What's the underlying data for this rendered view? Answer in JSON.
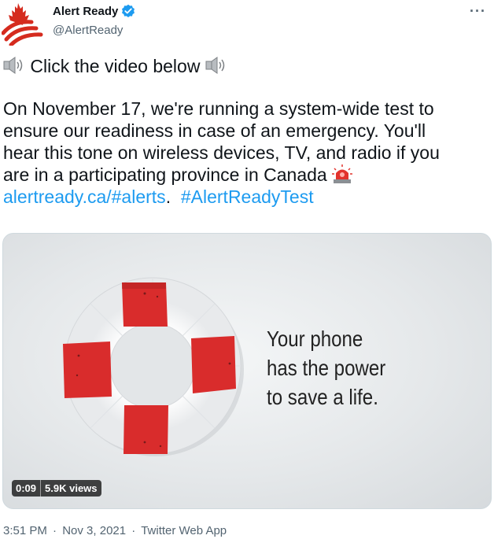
{
  "header": {
    "display_name": "Alert Ready",
    "handle": "@AlertReady",
    "more_label": "···"
  },
  "tweet": {
    "line1": "Click the video below",
    "para_lines": [
      "On November 17, we're running a system-wide test to",
      "ensure our readiness in case of an emergency. You'll",
      "hear this tone on wireless devices, TV, and radio if you",
      "are in a participating province in Canada"
    ],
    "link_text": "alertready.ca/#alerts",
    "link_sep": ".",
    "hashtag": "#AlertReadyTest"
  },
  "media": {
    "caption_lines": [
      "Your phone",
      "has the power",
      "to save a life."
    ],
    "duration": "0:09",
    "views": "5.9K views"
  },
  "footer": {
    "time": "3:51 PM",
    "date": "Nov 3, 2021",
    "source": "Twitter Web App",
    "separator": "·"
  },
  "colors": {
    "accent": "#1d9bf0",
    "text": "#0f1419",
    "muted": "#536471",
    "brand_red": "#d52b1e"
  },
  "icons": [
    "alert-ready-logo-icon",
    "verified-badge-icon",
    "speaker-icon",
    "siren-icon",
    "more-icon"
  ]
}
